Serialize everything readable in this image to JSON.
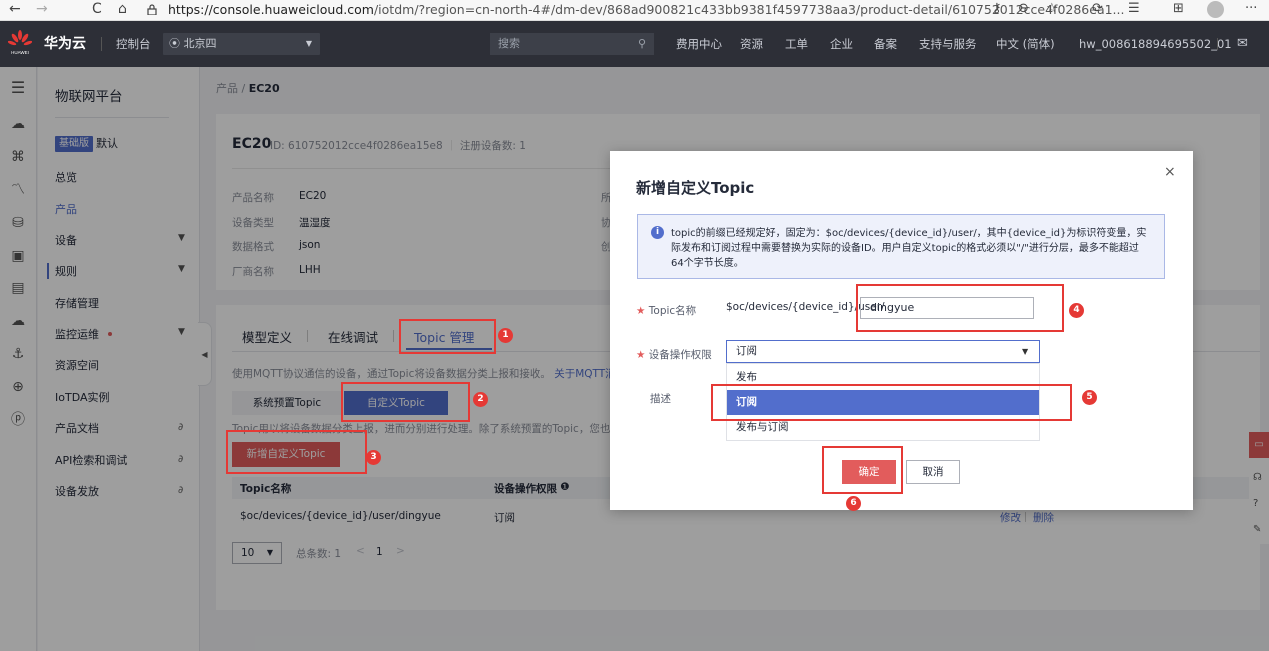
{
  "browser": {
    "back": "←",
    "forward": "→",
    "reload": "C",
    "home": "⌂",
    "lock": "🔒",
    "url_host": "https://console.huaweicloud.com",
    "url_path": "/iotdm/?region=cn-north-4#/dm-dev/868ad900821c433bb9381f4597738aa3/product-detail/610752012cce4f0286ea1...",
    "more": "···"
  },
  "topnav": {
    "brand": "华为云",
    "console": "控制台",
    "region": "北京四",
    "search_placeholder": "搜索",
    "items": [
      "费用中心",
      "资源",
      "工单",
      "企业",
      "备案",
      "支持与服务",
      "中文 (简体)",
      "hw_008618894695502_01"
    ]
  },
  "sidebar": {
    "title": "物联网平台",
    "edition_badge": "基础版",
    "edition_name": "默认",
    "items": [
      "总览",
      "产品",
      "设备",
      "规则",
      "存储管理",
      "监控运维",
      "资源空间",
      "IoTDA实例",
      "产品文档",
      "API检索和调试",
      "设备发放"
    ]
  },
  "breadcrumb": {
    "parent": "产品",
    "sep": " / ",
    "current": "EC20"
  },
  "product": {
    "name": "EC20",
    "id_text": "ID: 610752012cce4f0286ea15e8",
    "devices_text": "注册设备数: 1",
    "fields": [
      {
        "label": "产品名称",
        "value": "EC20"
      },
      {
        "label": "设备类型",
        "value": "温湿度"
      },
      {
        "label": "数据格式",
        "value": "json"
      },
      {
        "label": "厂商名称",
        "value": "LHH"
      }
    ],
    "col2_labels": [
      "所",
      "协",
      "创"
    ]
  },
  "tabs": [
    "模型定义",
    "在线调试",
    "Topic 管理"
  ],
  "topic_page": {
    "mqtt_desc": "使用MQTT协议通信的设备，通过Topic将设备数据分类上报和接收。",
    "mqtt_link": "关于MQTT消息的",
    "btn_preset": "系统预置Topic",
    "btn_custom": "自定义Topic",
    "topic_desc": "Topic用以将设备数据分类上报，进而分别进行处理。除了系统预置的Topic，您也可以",
    "btn_add": "新增自定义Topic",
    "col_name": "Topic名称",
    "col_perm": "设备操作权限",
    "col_perm_icon": "❶",
    "row": {
      "name": "$oc/devices/{device_id}/user/dingyue",
      "perm": "订阅",
      "edit": "修改",
      "delete": "删除"
    },
    "page_size": "10",
    "total": "总条数: 1",
    "prev": "<",
    "page": "1",
    "next": ">"
  },
  "modal": {
    "title": "新增自定义Topic",
    "close": "×",
    "info_icon": "i",
    "info_text": "topic的前缀已经规定好，固定为：$oc/devices/{device_id}/user/，其中{device_id}为标识符变量，实际发布和订阅过程中需要替换为实际的设备ID。用户自定义topic的格式必须以\"/\"进行分层，最多不能超过64个字节长度。",
    "required_mark": "★",
    "topic_label": "Topic名称",
    "topic_prefix": "$oc/devices/{device_id}/user/",
    "topic_value": "dingyue",
    "perm_label": "设备操作权限",
    "perm_value": "订阅",
    "perm_options": [
      "发布",
      "订阅",
      "发布与订阅"
    ],
    "desc_label": "描述",
    "confirm": "确定",
    "cancel": "取消"
  },
  "steps": [
    "1",
    "2",
    "3",
    "4",
    "5",
    "6"
  ],
  "colors": {
    "accent": "#526ecc",
    "danger": "#e25c5c",
    "annotation": "#e53935",
    "topbar": "#2d2f37"
  }
}
